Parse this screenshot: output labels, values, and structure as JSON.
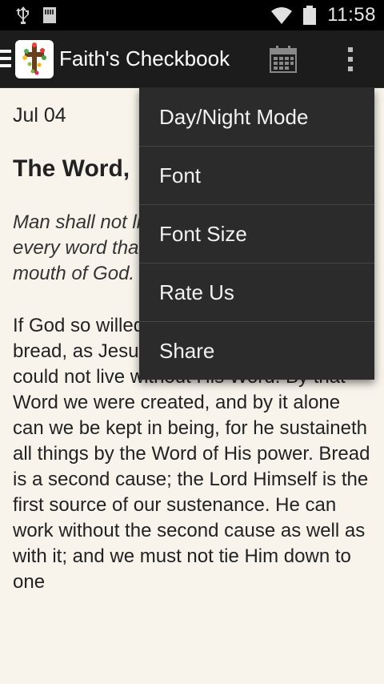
{
  "status_bar": {
    "time": "11:58",
    "icons": [
      "usb-icon",
      "sd-card-icon",
      "wifi-icon",
      "battery-icon"
    ]
  },
  "action_bar": {
    "title": "Faith's Checkbook",
    "icons": [
      "drawer-icon",
      "app-cross-icon",
      "calendar-icon",
      "overflow-menu-icon"
    ]
  },
  "content": {
    "date": "Jul 04",
    "title": "The Word,",
    "verse": "Man shall not live by bread alone, but by every word that proceedeth out of the mouth of God.",
    "body": "If God so willed, we could live without bread, as Jesus did for forty days; but we could not live without His Word. By that Word we were created, and by it alone can we be kept in being, for he sustaineth all things by the Word of His power. Bread is a second cause; the Lord Himself is the first source of our sustenance. He can work without the second cause as well as with it; and we must not tie Him down to one"
  },
  "menu": {
    "items": [
      "Day/Night Mode",
      "Font",
      "Font Size",
      "Rate Us",
      "Share"
    ]
  },
  "colors": {
    "status_bar_bg": "#000000",
    "action_bar_bg": "#1c1c1c",
    "content_bg": "#f8f4ec",
    "menu_bg": "#2b2b2b"
  }
}
